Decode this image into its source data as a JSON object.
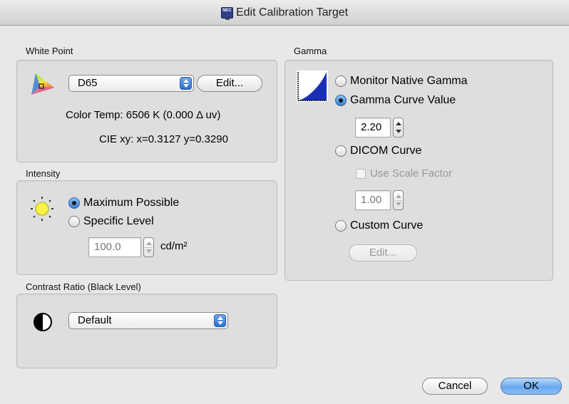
{
  "window": {
    "title": "Edit Calibration Target",
    "app_icon_text": "NEC"
  },
  "white_point": {
    "label": "White Point",
    "icon": "color-gamut-icon",
    "selected": "D65",
    "edit_label": "Edit...",
    "color_temp": "Color Temp: 6506 K (0.000 Δ uv)",
    "cie_xy": "CIE xy: x=0.3127 y=0.3290"
  },
  "intensity": {
    "label": "Intensity",
    "icon": "brightness-sun-icon",
    "option_max": "Maximum Possible",
    "option_specific": "Specific Level",
    "selected": "Maximum Possible",
    "level_value": "100.0",
    "unit": "cd/m²"
  },
  "contrast": {
    "label": "Contrast Ratio (Black Level)",
    "icon": "contrast-icon",
    "selected": "Default"
  },
  "gamma": {
    "label": "Gamma",
    "icon": "gamma-curve-icon",
    "option_native": "Monitor Native Gamma",
    "option_curve_value": "Gamma Curve Value",
    "curve_value": "2.20",
    "option_dicom": "DICOM Curve",
    "use_scale_factor": "Use Scale Factor",
    "scale_value": "1.00",
    "option_custom": "Custom Curve",
    "custom_edit_label": "Edit...",
    "selected": "Gamma Curve Value"
  },
  "buttons": {
    "cancel": "Cancel",
    "ok": "OK"
  },
  "colors": {
    "accent": "#3a7fd8",
    "panel": "#dedede",
    "window": "#e8e8e8"
  }
}
